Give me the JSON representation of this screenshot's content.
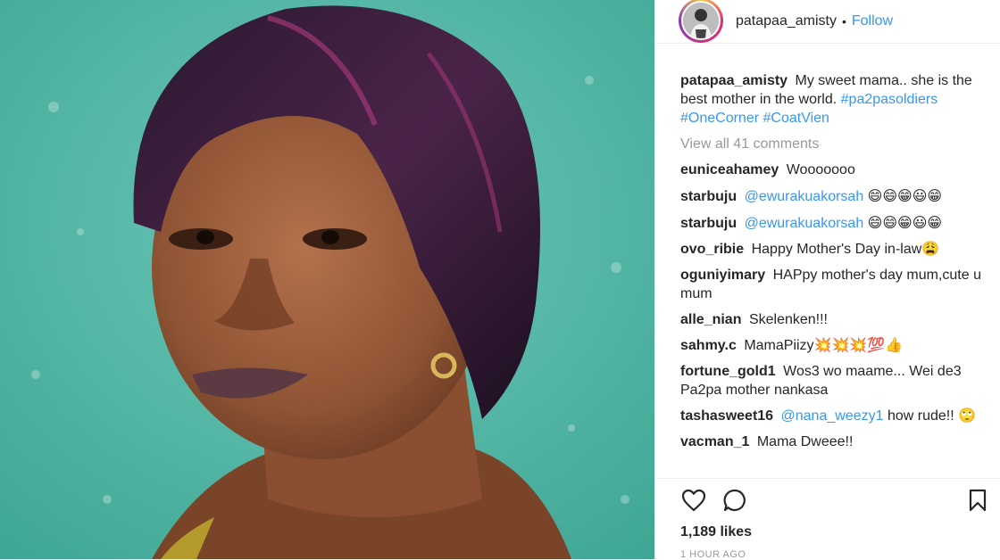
{
  "header": {
    "username": "patapaa_amisty",
    "separator": "•",
    "follow_label": "Follow"
  },
  "caption": {
    "username": "patapaa_amisty",
    "text": "My sweet mama.. she is the best mother in the world.",
    "hashtags": [
      "#pa2pasoldiers",
      "#OneCorner",
      "#CoatVien"
    ]
  },
  "view_all": "View all 41 comments",
  "comments": [
    {
      "user": "euniceahamey",
      "text": "Wooooooo"
    },
    {
      "user": "starbuju",
      "mention": "@ewurakuakorsah",
      "text": "😄😄😁😃😁"
    },
    {
      "user": "starbuju",
      "mention": "@ewurakuakorsah",
      "text": "😄😄😁😃😁"
    },
    {
      "user": "ovo_ribie",
      "text": "Happy Mother's Day in-law😩"
    },
    {
      "user": "oguniyimary",
      "text": "HAPpy mother's day mum,cute u mum"
    },
    {
      "user": "alle_nian",
      "text": "Skelenken!!!"
    },
    {
      "user": "sahmy.c",
      "text": "MamaPiizy💥💥💥💯👍"
    },
    {
      "user": "fortune_gold1",
      "text": "Wos3 wo maame... Wei de3 Pa2pa mother nankasa"
    },
    {
      "user": "tashasweet16",
      "mention": "@nana_weezy1",
      "text": "how rude!! 🙄"
    },
    {
      "user": "vacman_1",
      "text": "Mama Dweee!!"
    }
  ],
  "actions": {
    "like_icon": "heart-icon",
    "comment_icon": "comment-bubble-icon",
    "save_icon": "bookmark-icon"
  },
  "likes": "1,189 likes",
  "timestamp": "1 HOUR AGO",
  "colors": {
    "link": "#3897f0",
    "muted": "#999999",
    "text": "#262626",
    "wall": "#4fb4a3"
  }
}
